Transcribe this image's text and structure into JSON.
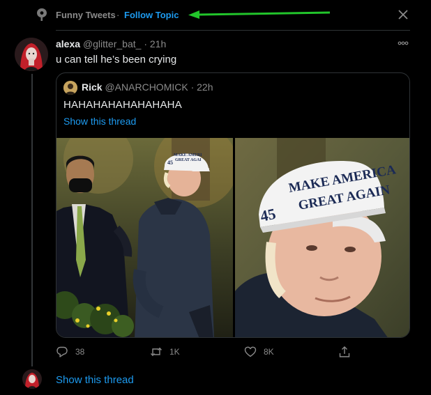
{
  "topic": {
    "name": "Funny Tweets",
    "separator": "·",
    "follow_label": "Follow Topic"
  },
  "annotation": {
    "arrow_color": "#22c52b"
  },
  "tweet": {
    "author_name": "alexa",
    "author_handle": "@glitter_bat_",
    "time_separator": "·",
    "time": "21h",
    "text": "u can tell he’s been crying"
  },
  "quote": {
    "author_name": "Rick",
    "author_handle": "@ANARCHOMICK",
    "time": "· 22h",
    "text": "HAHAHAHAHAHAHAHA",
    "thread_link": "Show this thread",
    "cap_text_line1": "MAKE AMERICA",
    "cap_text_line2": "GREAT AGAIN",
    "cap_number": "45"
  },
  "actions": {
    "reply_count": "38",
    "retweet_count": "1K",
    "like_count": "8K"
  },
  "footer": {
    "thread_link": "Show this thread"
  },
  "colors": {
    "accent": "#1d9bf0",
    "background": "#000000",
    "muted_text": "#8b8b8b",
    "primary_text": "#e7e9ea",
    "border": "#2f3336"
  }
}
